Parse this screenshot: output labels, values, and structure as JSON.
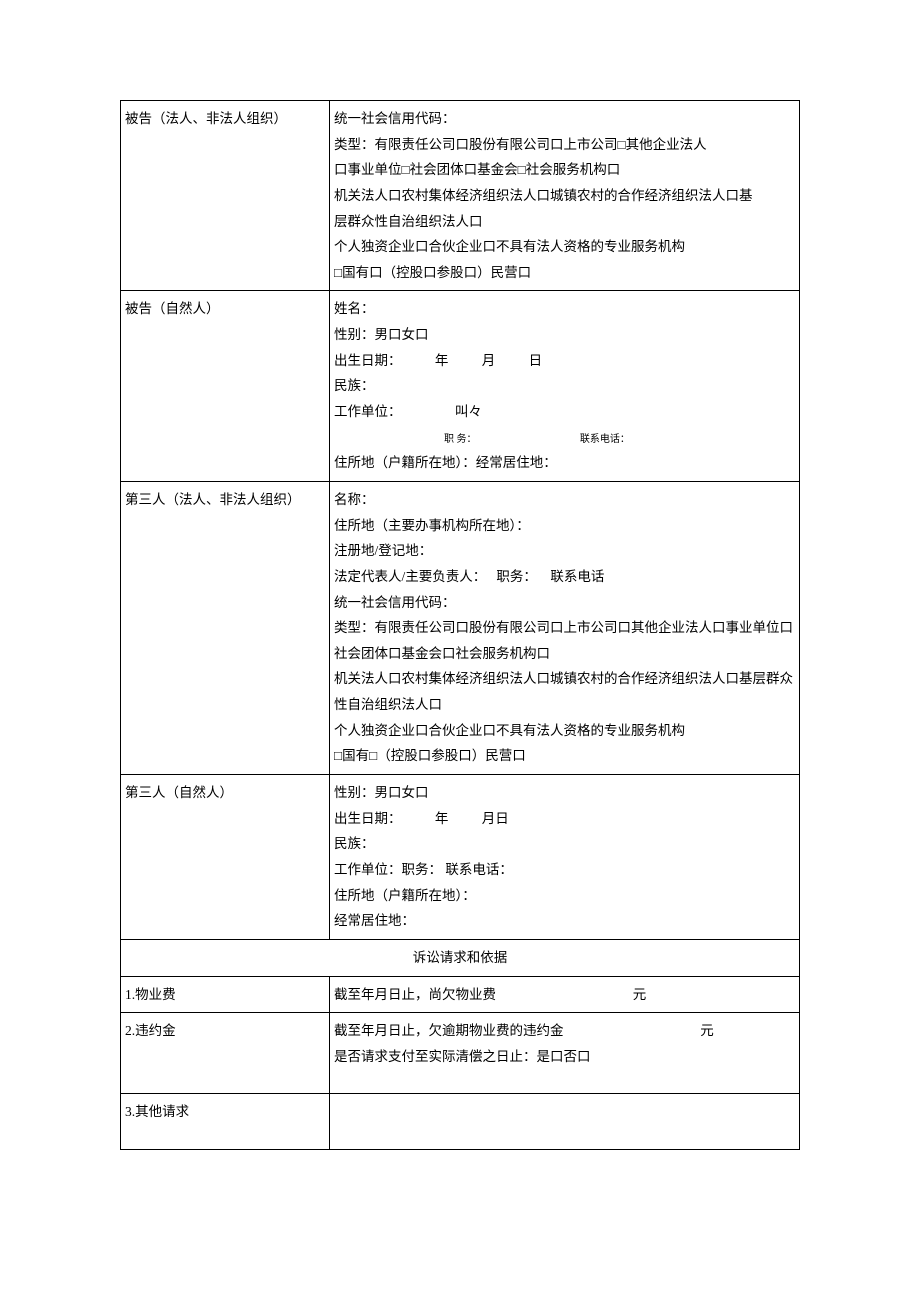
{
  "rows": {
    "defendant_legal": {
      "label": "被告（法人、非法人组织）",
      "l1": "统一社会信用代码：",
      "l2": "类型：有限责任公司口股份有限公司口上市公司□其他企业法人",
      "l3": "口事业单位□社会团体口基金会□社会服务机构口",
      "l4": "机关法人口农村集体经济组织法人口城镇农村的合作经济组织法人口基",
      "l5": "层群众性自治组织法人口",
      "l6": "个人独资企业口合伙企业口不具有法人资格的专业服务机构",
      "l7": "□国有口（控股口参股口）民营口"
    },
    "defendant_natural": {
      "label": "被告（自然人）",
      "l1": "姓名：",
      "l2": "性别：男口女口",
      "l3a": "出生日期：",
      "l3y": "年",
      "l3m": "月",
      "l3d": "日",
      "l4": "民族：",
      "l5a": "工作单位：",
      "l5b": "叫々",
      "l6a": "职 务：",
      "l6b": "联系电话：",
      "l7": "住所地（户籍所在地）：经常居住地："
    },
    "third_legal": {
      "label": "第三人（法人、非法人组织）",
      "l1": "名称：",
      "l2": "住所地（主要办事机构所在地）：",
      "l3": "注册地/登记地：",
      "l4a": "法定代表人/主要负责人：",
      "l4b": "职务：",
      "l4c": "联系电话",
      "l5": "统一社会信用代码：",
      "l6": "类型：有限责任公司口股份有限公司口上市公司口其他企业法人口事业单位口社会团体口基金会口社会服务机构口",
      "l7": "机关法人口农村集体经济组织法人口城镇农村的合作经济组织法人口基层群众性自治组织法人口",
      "l8": "个人独资企业口合伙企业口不具有法人资格的专业服务机构",
      "l9": "□国有□（控股口参股口）民营口"
    },
    "third_natural": {
      "label": "第三人（自然人）",
      "l1": "性别：男口女口",
      "l2a": "出生日期：",
      "l2y": "年",
      "l2md": "月日",
      "l3": "民族：",
      "l4": "工作单位：职务：   联系电话：",
      "l5": "住所地（户籍所在地）：",
      "l6": "经常居住地："
    },
    "section_title": "诉讼请求和依据",
    "item1": {
      "label": "1.物业费",
      "txt_a": "截至年月日止，尚欠物业费",
      "txt_b": "元"
    },
    "item2": {
      "label": "2.违约金",
      "txt_a": "截至年月日止，欠逾期物业费的违约金",
      "txt_b": "元",
      "txt_c": "是否请求支付至实际清偿之日止：是口否口"
    },
    "item3": {
      "label": "3.其他请求"
    }
  }
}
